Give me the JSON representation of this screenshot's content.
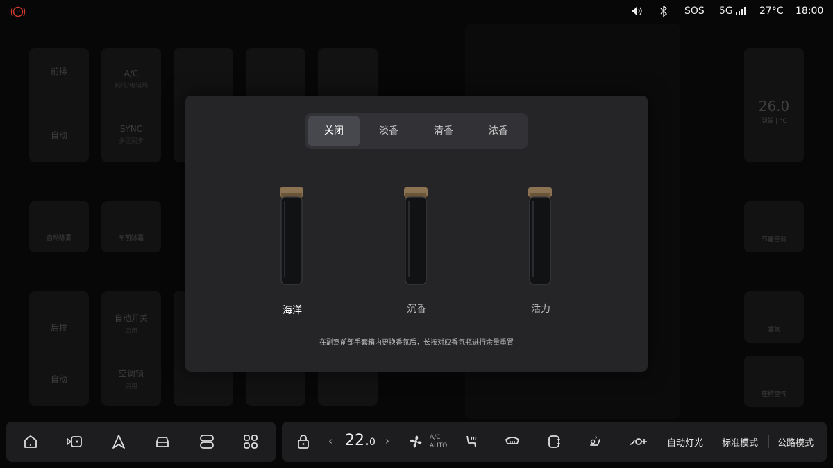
{
  "status": {
    "park_label": "P",
    "sos": "SOS",
    "network": "5G",
    "temperature": "27°C",
    "time": "18:00"
  },
  "background": {
    "front_power": "前排",
    "front_auto": "自动",
    "ac": "A/C",
    "ac_sub": "制冷/电辅热",
    "sync": "SYNC",
    "sync_sub": "多区同步",
    "auto_defog": "自动除雾",
    "front_defrost": "车前除霜",
    "rear_power": "后排",
    "rear_auto": "自动",
    "auto_switch": "自动开关",
    "auto_switch_sub": "启用",
    "ac_lock": "空调锁",
    "ac_lock_sub": "启用",
    "right_temp": "26.0",
    "right_temp_unit": "副驾 | °C",
    "eco": "节能空调",
    "fragrance": "香氛",
    "seat_cleaner": "座椅空气"
  },
  "modal": {
    "tabs": [
      "关闭",
      "淡香",
      "清香",
      "浓香"
    ],
    "active_tab": 0,
    "bottles": [
      "海洋",
      "沉香",
      "活力"
    ],
    "selected_bottle": 0,
    "hint": "在副驾前部手套箱内更换香氛后，长按对应香氛瓶进行余量重置"
  },
  "dock": {
    "icons": [
      "home-icon",
      "media-icon",
      "navigation-icon",
      "car-icon",
      "controls-icon",
      "apps-icon"
    ],
    "temperature_int": "22.",
    "temperature_dec": "0",
    "ac_label": "A/C",
    "auto_label": "AUTO",
    "auto_lights": "自动灯光",
    "standard_mode": "标准模式",
    "road_mode": "公路模式"
  },
  "colors": {
    "background": "#070707",
    "modal": "#252527",
    "active_tab": "#47484e",
    "park_red": "#d03a2f"
  }
}
